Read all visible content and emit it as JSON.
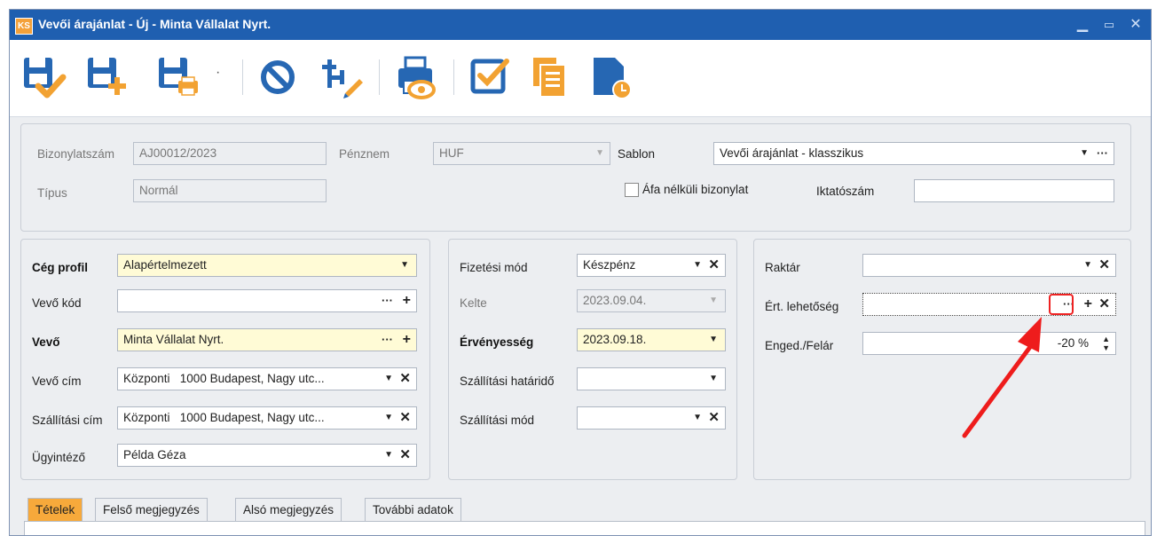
{
  "window": {
    "app_badge": "KS",
    "title": "Vevői árajánlat - Új - Minta Vállalat Nyrt."
  },
  "toolbar": {
    "items": [
      "save-confirm",
      "save-new",
      "save-print",
      "cancel",
      "tree-edit",
      "print-preview",
      "approve",
      "copy",
      "document-clock"
    ]
  },
  "header": {
    "doc_number_label": "Bizonylatszám",
    "doc_number": "AJ00012/2023",
    "currency_label": "Pénznem",
    "currency": "HUF",
    "template_label": "Sablon",
    "template": "Vevői árajánlat - klasszikus",
    "type_label": "Típus",
    "type": "Normál",
    "vat_free_label": "Áfa nélküli bizonylat",
    "filing_label": "Iktatószám",
    "filing": ""
  },
  "customer": {
    "company_profile_label": "Cég profil",
    "company_profile": "Alapértelmezett",
    "customer_code_label": "Vevő kód",
    "customer_code": "",
    "customer_label": "Vevő",
    "customer": "Minta Vállalat Nyrt.",
    "customer_address_label": "Vevő cím",
    "customer_address": "Központi   1000 Budapest, Nagy utc...",
    "shipping_address_label": "Szállítási cím",
    "shipping_address": "Központi   1000 Budapest, Nagy utc...",
    "agent_label": "Ügyintéző",
    "agent": "Példa Géza"
  },
  "payment": {
    "method_label": "Fizetési mód",
    "method": "Készpénz",
    "issued_label": "Kelte",
    "issued": "2023.09.04.",
    "validity_label": "Érvényesség",
    "validity": "2023.09.18.",
    "delivery_deadline_label": "Szállítási határidő",
    "delivery_deadline": "",
    "delivery_method_label": "Szállítási mód",
    "delivery_method": ""
  },
  "sales": {
    "warehouse_label": "Raktár",
    "warehouse": "",
    "opportunity_label": "Ért. lehetőség",
    "opportunity": "",
    "discount_label": "Enged./Felár",
    "discount": "-20 %"
  },
  "tabs": [
    "Tételek",
    "Felső megjegyzés",
    "Alsó megjegyzés",
    "További adatok"
  ],
  "colors": {
    "titlebar": "#1f5fb0",
    "accent_tab": "#f7a93b",
    "required_field": "#fffbd6",
    "highlight": "#e22222"
  }
}
